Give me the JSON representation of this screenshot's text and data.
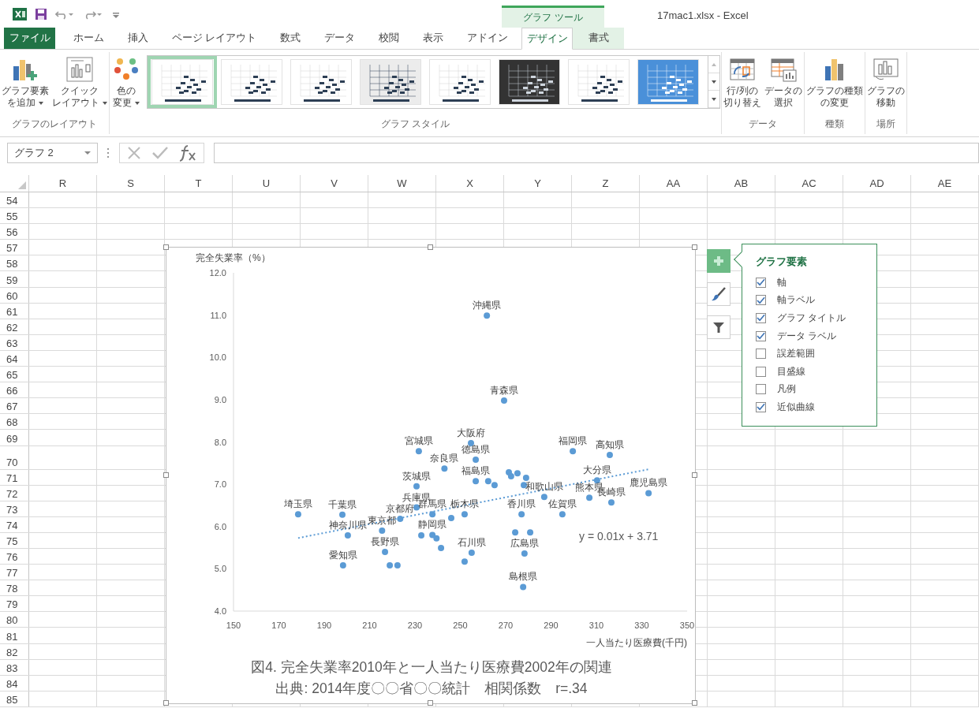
{
  "title_bar": {
    "title": "17mac1.xlsx - Excel",
    "context_group": "グラフ ツール"
  },
  "ribbon_tabs": [
    {
      "label": "ファイル",
      "kind": "file",
      "selected": false
    },
    {
      "label": "ホーム",
      "kind": "tab",
      "selected": false
    },
    {
      "label": "挿入",
      "kind": "tab",
      "selected": false
    },
    {
      "label": "ページ レイアウト",
      "kind": "tab",
      "selected": false
    },
    {
      "label": "数式",
      "kind": "tab",
      "selected": false
    },
    {
      "label": "データ",
      "kind": "tab",
      "selected": false
    },
    {
      "label": "校閲",
      "kind": "tab",
      "selected": false
    },
    {
      "label": "表示",
      "kind": "tab",
      "selected": false
    },
    {
      "label": "アドイン",
      "kind": "tab",
      "selected": false
    },
    {
      "label": "デザイン",
      "kind": "context",
      "selected": true
    },
    {
      "label": "書式",
      "kind": "context",
      "selected": false
    }
  ],
  "ribbon_groups": [
    {
      "label": "グラフのレイアウト",
      "buttons": [
        {
          "kind": "add-element",
          "lines": [
            "グラフ要素",
            "を追加"
          ],
          "dropdown": true
        },
        {
          "kind": "quick-layout",
          "lines": [
            "クイック",
            "レイアウト"
          ],
          "dropdown": true
        }
      ]
    },
    {
      "label": "グラフ スタイル",
      "buttons": [
        {
          "kind": "colors",
          "lines": [
            "色の",
            "変更"
          ],
          "dropdown": true
        }
      ],
      "gallery": [
        {
          "kind": "white",
          "selected": true
        },
        {
          "kind": "white",
          "selected": false
        },
        {
          "kind": "white",
          "selected": false
        },
        {
          "kind": "gray",
          "selected": false
        },
        {
          "kind": "white",
          "selected": false
        },
        {
          "kind": "dark",
          "selected": false
        },
        {
          "kind": "white",
          "selected": false
        },
        {
          "kind": "blue",
          "selected": false
        }
      ]
    },
    {
      "label": "データ",
      "buttons": [
        {
          "kind": "switch",
          "lines": [
            "行/列の",
            "切り替え"
          ],
          "dropdown": false
        },
        {
          "kind": "select-data",
          "lines": [
            "データの",
            "選択"
          ],
          "dropdown": false
        }
      ]
    },
    {
      "label": "種類",
      "buttons": [
        {
          "kind": "change-type",
          "lines": [
            "グラフの種類",
            "の変更"
          ],
          "dropdown": false
        }
      ]
    },
    {
      "label": "場所",
      "buttons": [
        {
          "kind": "move",
          "lines": [
            "グラフの",
            "移動"
          ],
          "dropdown": false
        }
      ]
    }
  ],
  "formula_bar": {
    "name_box": "グラフ 2"
  },
  "columns": [
    "R",
    "S",
    "T",
    "U",
    "V",
    "W",
    "X",
    "Y",
    "Z",
    "AA",
    "AB",
    "AC",
    "AD",
    "AE"
  ],
  "rows": [
    "54",
    "55",
    "56",
    "57",
    "58",
    "59",
    "60",
    "61",
    "62",
    "63",
    "64",
    "65",
    "66",
    "67",
    "68",
    "69",
    "70",
    "71",
    "72",
    "73",
    "74",
    "75",
    "76",
    "77",
    "78",
    "79",
    "80",
    "81",
    "82",
    "83",
    "84",
    "85"
  ],
  "chart": {
    "trendline": {
      "equation": "y = 0.01x + 3.71"
    },
    "caption": [
      "図4. 完全失業率2010年と一人当たり医療費2002年の関連",
      "出典: 2014年度〇〇省〇〇統計　相関係数　r=.34"
    ],
    "chart_data": {
      "type": "scatter",
      "xlabel": "一人当たり医療費(千円)",
      "ylabel": "完全失業率（%）",
      "x": [
        261.7,
        269.3,
        254.7,
        231.7,
        299.6,
        315.9,
        256.8,
        243.0,
        272.4,
        271.4,
        275.2,
        310.3,
        279.0,
        256.8,
        262.3,
        265.1,
        278.0,
        333.0,
        306.9,
        287.0,
        230.7,
        316.6,
        230.7,
        178.5,
        237.7,
        251.9,
        277.0,
        295.0,
        223.5,
        246.0,
        198.0,
        237.7,
        215.5,
        274.2,
        280.8,
        200.4,
        232.8,
        239.5,
        241.5,
        216.8,
        255.0,
        278.3,
        251.9,
        198.3,
        218.9,
        222.3,
        277.7
      ],
      "series": [
        {
          "color": "#5b9bd5",
          "values": [
            10.99,
            8.98,
            7.97,
            7.78,
            7.78,
            7.69,
            7.58,
            7.37,
            7.19,
            7.28,
            7.26,
            7.09,
            7.15,
            7.07,
            7.07,
            6.98,
            6.98,
            6.79,
            6.68,
            6.7,
            6.95,
            6.57,
            6.45,
            6.29,
            6.29,
            6.29,
            6.29,
            6.29,
            6.18,
            6.2,
            6.28,
            5.8,
            5.9,
            5.86,
            5.86,
            5.79,
            5.79,
            5.72,
            5.49,
            5.4,
            5.38,
            5.36,
            5.17,
            5.08,
            5.08,
            5.08,
            4.57
          ],
          "value_labels": [
            "沖縄県",
            "青森県",
            "大阪府",
            "宮城県",
            "福岡県",
            "高知県",
            "徳島県",
            "奈良県",
            null,
            null,
            null,
            "大分県",
            null,
            "福島県",
            null,
            null,
            null,
            "鹿児島県",
            "熊本県",
            "和歌山県",
            "茨城県",
            "長崎県",
            "兵庫県",
            "埼玉県",
            "群馬県",
            "栃木県",
            "香川県",
            "佐賀県",
            "京都府",
            null,
            "千葉県",
            "静岡県",
            "東京都",
            null,
            null,
            "神奈川県",
            null,
            null,
            null,
            "長野県",
            "石川県",
            "広島県",
            null,
            "愛知県",
            null,
            null,
            "島根県"
          ]
        }
      ],
      "xlim": [
        150,
        350
      ],
      "ylim": [
        4,
        12
      ],
      "xticks": [
        150,
        170,
        190,
        210,
        230,
        250,
        270,
        290,
        310,
        330,
        350
      ],
      "yticks": [
        {
          "value": 4,
          "label": "4.0"
        },
        {
          "value": 5,
          "label": "5.0"
        },
        {
          "value": 6,
          "label": "6.0"
        },
        {
          "value": 7,
          "label": "7.0"
        },
        {
          "value": 8,
          "label": "8.0"
        },
        {
          "value": 9,
          "label": "9.0"
        },
        {
          "value": 10,
          "label": "10.0"
        },
        {
          "value": 11,
          "label": "11.0"
        },
        {
          "value": 12,
          "label": "12.0"
        }
      ]
    }
  },
  "chart_tools": [
    {
      "kind": "plus",
      "selected": true
    },
    {
      "kind": "brush",
      "selected": false
    },
    {
      "kind": "filter",
      "selected": false
    }
  ],
  "elements_panel": {
    "title": "グラフ要素",
    "items": [
      {
        "label": "軸",
        "checked": true
      },
      {
        "label": "軸ラベル",
        "checked": true
      },
      {
        "label": "グラフ タイトル",
        "checked": true
      },
      {
        "label": "データ ラベル",
        "checked": true
      },
      {
        "label": "誤差範囲",
        "checked": false
      },
      {
        "label": "目盛線",
        "checked": false
      },
      {
        "label": "凡例",
        "checked": false
      },
      {
        "label": "近似曲線",
        "checked": true
      }
    ]
  }
}
